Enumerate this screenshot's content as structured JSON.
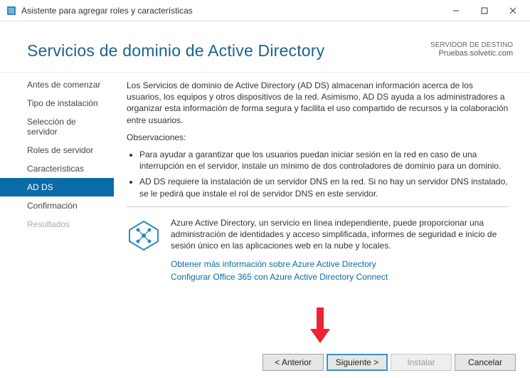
{
  "window": {
    "title": "Asistente para agregar roles y características"
  },
  "header": {
    "title": "Servicios de dominio de Active Directory",
    "destination_label": "SERVIDOR DE DESTINO",
    "destination_value": "Pruebas.solvetic.com"
  },
  "sidebar": {
    "items": [
      {
        "label": "Antes de comenzar"
      },
      {
        "label": "Tipo de instalación"
      },
      {
        "label": "Selección de servidor"
      },
      {
        "label": "Roles de servidor"
      },
      {
        "label": "Características"
      },
      {
        "label": "AD DS"
      },
      {
        "label": "Confirmación"
      },
      {
        "label": "Resultados"
      }
    ]
  },
  "content": {
    "intro": "Los Servicios de dominio de Active Directory (AD DS) almacenan información acerca de los usuarios, los equipos y otros dispositivos de la red. Asimismo, AD DS ayuda a los administradores a organizar esta información de forma segura y facilita el uso compartido de recursos y la colaboración entre usuarios.",
    "observaciones_label": "Observaciones:",
    "bullets": [
      "Para ayudar a garantizar que los usuarios puedan iniciar sesión en la red en caso de una interrupción en el servidor, instale un mínimo de dos controladores de dominio para un dominio.",
      "AD DS requiere la instalación de un servidor DNS en la red. Si no hay un servidor DNS instalado, se le pedirá que instale el rol de servidor DNS en este servidor."
    ],
    "azure": {
      "text": "Azure Active Directory, un servicio en línea independiente, puede proporcionar una administración de identidades y acceso simplificada, informes de seguridad e inicio de sesión único en las aplicaciones web en la nube y locales.",
      "link1": "Obtener más información sobre Azure Active Directory",
      "link2": "Configurar Office 365 con Azure Active Directory Connect"
    }
  },
  "footer": {
    "back": "< Anterior",
    "next": "Siguiente >",
    "install": "Instalar",
    "cancel": "Cancelar"
  }
}
